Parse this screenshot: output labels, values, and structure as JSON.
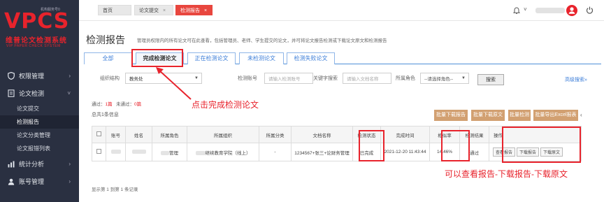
{
  "sidebar": {
    "logo": {
      "badge": "机构服务号0",
      "brand": "VPCS",
      "name_cn": "维普论文检测系统",
      "name_en": "VIP PAPER CHECK SYSTEM"
    },
    "menu": [
      {
        "label": "权限管理",
        "icon": "shield-icon"
      },
      {
        "label": "论文检测",
        "icon": "document-icon"
      }
    ],
    "submenu": [
      "论文提交",
      "检测报告",
      "论文分类管理",
      "论文报错列表"
    ],
    "menu_bottom": [
      {
        "label": "统计分析",
        "icon": "chart-icon"
      },
      {
        "label": "账号管理",
        "icon": "user-icon"
      }
    ]
  },
  "topbar": {
    "tabs": [
      {
        "label": "首页"
      },
      {
        "label": "论文提交"
      },
      {
        "label": "检测报告"
      }
    ],
    "close_glyph": "×"
  },
  "page": {
    "title": "检测报告",
    "description": "管理员权限内的所有论文可在此查看，包括管理员、老师、学生提交的论文，并可将论文报告检测或下载论文原文和检测报告"
  },
  "subtabs": [
    "全部",
    "完成检测论文",
    "正在检测论文",
    "未检测论文",
    "检测失败论文"
  ],
  "filters": {
    "org_label": "组织结构",
    "org_value": "教务处",
    "account_label": "检测账号",
    "account_placeholder": "请输入检测账号",
    "keyword_label": "关键字搜索",
    "keyword_placeholder": "请输入文档名称",
    "role_label": "所属角色",
    "role_value": "--请选择角色--",
    "query_button": "搜索",
    "advanced": "高级搜索»"
  },
  "stats": {
    "pass_label": "通过：",
    "pass_count": "1篇",
    "fail_label": "未通过：",
    "fail_count": "0篇"
  },
  "total": "总共1条信息",
  "actions": [
    "批量下载报告",
    "批量下载原文",
    "批量检测",
    "批量导出Excel报表"
  ],
  "table": {
    "headers": [
      "",
      "账号",
      "姓名",
      "所属角色",
      "所属组织",
      "所属分类",
      "文档名称",
      "检测状态",
      "完成时间",
      "相似率",
      "检测结果",
      "操作"
    ],
    "row": {
      "role": "管理",
      "org": "继续教育学院（线上）",
      "category": "-",
      "doc": "1234567+张三+论财务管理",
      "status": "已完成",
      "time": "2021-12-20 11:43:44",
      "similarity": "14.46%",
      "result": "通过",
      "ops": [
        "查看报告",
        "下载报告",
        "下载原文"
      ]
    }
  },
  "pager": "显示第 1 到第 1 条记录",
  "annotations": {
    "click_complete": "点击完成检测论文",
    "view_download": "可以查看报告-下载报告-下载原文"
  },
  "colors": {
    "sidebar": "#2a3041",
    "accent_red": "#e8232c",
    "tab_active": "#e8463e",
    "action_button": "#d2a071",
    "link_blue": "#3b7dd8"
  }
}
